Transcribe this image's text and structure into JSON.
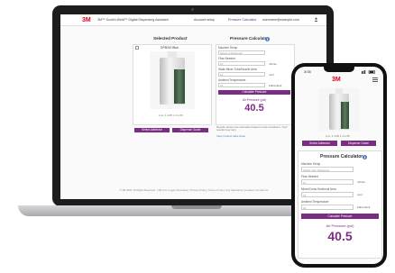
{
  "laptop": {
    "header": {
      "logo": "3M",
      "app_title": "3M™ Scotch-Weld™ Digital Dispensing Assistant",
      "nav": [
        "Account setup",
        "Pressure Calculator",
        "username@example.com"
      ]
    },
    "selected_product": {
      "heading": "Selected Product",
      "product_name": "DP8010 Blue",
      "caption": "2-pt, 1:1/45 1:1:1/45",
      "buttons": [
        "Select Adhesive",
        "Dispense Guide"
      ]
    },
    "calculator": {
      "heading": "Pressure Calculator",
      "fields": [
        {
          "label": "Machine Setup",
          "value": "Select a Dispenser",
          "unit": ""
        },
        {
          "label": "Flow Needed",
          "value": "10",
          "unit": "ml/min"
        },
        {
          "label": "Static Mixer Tube/Nozzle Area",
          "value": "10",
          "unit": "mm²"
        },
        {
          "label": "Ambient Temperature",
          "value": "23",
          "unit": "Fahrenheit"
        }
      ],
      "button": "Calculate Pressure",
      "result_label": "Air Pressure (psi)",
      "result_value": "40.5",
      "note": "Results shown are estimates based on lab conditions. Your results may vary.",
      "link": "View product data sheet"
    },
    "footer": "© 3M 2023. All Rights Reserved. | 3M.com | Legal Information | Privacy Policy | Terms of Use | Your Selections | Cookies | Contact Us"
  },
  "phone": {
    "status_time": "3:05",
    "logo": "3M",
    "product_caption": "2-pt, 1:1/45 1:1:1/45",
    "buttons": [
      "Select Adhesive",
      "Dispense Guide"
    ],
    "calculator": {
      "heading": "Pressure Calculator",
      "fields": [
        {
          "label": "Machine Setup",
          "value": "Select Your Dispenser",
          "unit": ""
        },
        {
          "label": "Flow Needed",
          "value": "10",
          "unit": "ml/min"
        },
        {
          "label": "Mixer/Cross-Sectional Area",
          "value": "12",
          "unit": "mm²"
        },
        {
          "label": "Ambient Temperature",
          "value": "23",
          "unit": "Fahrenheit"
        }
      ],
      "button": "Calculate Pressure",
      "result_label": "Air Pressure (psi)",
      "result_value": "40.5"
    }
  },
  "colors": {
    "brand": "#e0001b",
    "accent": "#7b2c83",
    "link": "#4a7fc1"
  },
  "icons": [
    "info-icon",
    "user-icon",
    "signal-icon",
    "battery-icon",
    "menu-icon"
  ]
}
